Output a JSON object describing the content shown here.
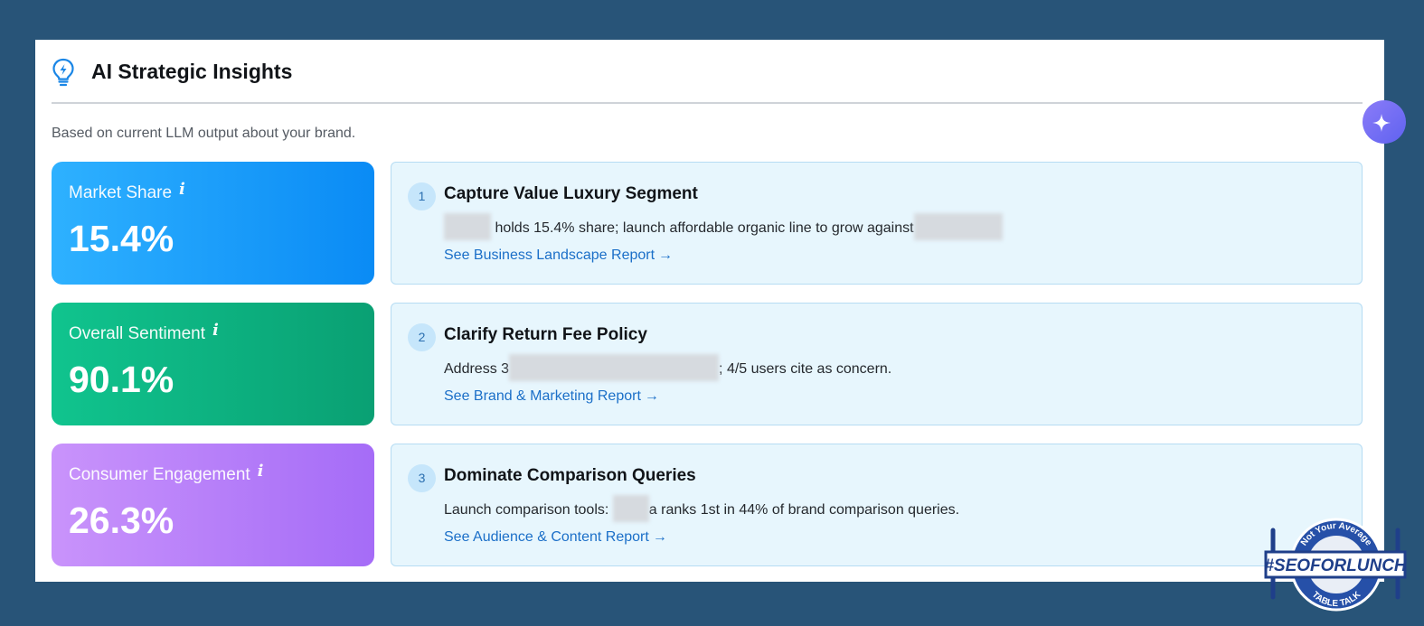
{
  "header": {
    "title": "AI Strategic Insights",
    "subtitle": "Based on current LLM output about your brand."
  },
  "metrics": [
    {
      "label": "Market Share",
      "value": "15.4%",
      "info_icon": "i"
    },
    {
      "label": "Overall Sentiment",
      "value": "90.1%",
      "info_icon": "i"
    },
    {
      "label": "Consumer Engagement",
      "value": "26.3%",
      "info_icon": "i"
    }
  ],
  "insights": [
    {
      "number": "1",
      "title": "Capture Value Luxury Segment",
      "desc_a": "holds 15.4% share; launch affordable organic line to grow against",
      "desc_b": "",
      "link": "See Business Landscape Report",
      "arrow": "→"
    },
    {
      "number": "2",
      "title": "Clarify Return Fee Policy",
      "desc_a": "Address 3",
      "desc_b": "; 4/5 users cite as concern.",
      "link": "See Brand & Marketing Report",
      "arrow": "→"
    },
    {
      "number": "3",
      "title": "Dominate Comparison Queries",
      "desc_a": "Launch comparison tools:",
      "desc_b": "a ranks 1st in 44% of brand comparison queries.",
      "link": "See Audience & Content Report",
      "arrow": "→"
    }
  ],
  "watermark": {
    "top_text": "Not Your Average",
    "main_text": "#SEOFORLUNCH",
    "bottom_text": "TABLE TALK"
  },
  "colors": {
    "background": "#285478",
    "link": "#1b6fc8",
    "insight_bg": "#e7f6fd",
    "market_share": "#0a8bf5",
    "sentiment": "#0aa073",
    "engagement": "#a56cf7"
  },
  "icons": {
    "header": "lightbulb-icon",
    "fab": "sparkle-icon",
    "info": "info-icon",
    "link_arrow": "arrow-right-icon"
  }
}
